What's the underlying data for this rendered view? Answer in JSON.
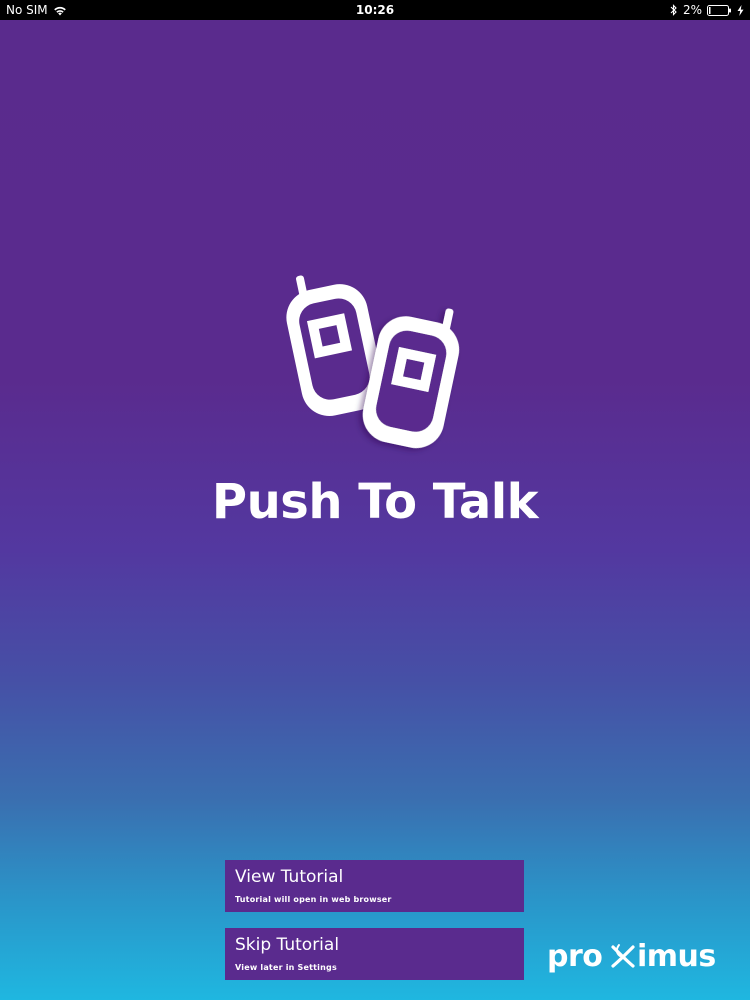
{
  "status_bar": {
    "carrier": "No SIM",
    "time": "10:26",
    "battery": "2%",
    "icons": [
      "wifi-icon",
      "bluetooth-icon",
      "battery-icon",
      "charging-bolt-icon"
    ]
  },
  "app": {
    "title": "Push To Talk",
    "logo_icon": "walkie-talkie-icon"
  },
  "buttons": {
    "view_tutorial": {
      "label": "View Tutorial",
      "sublabel": "Tutorial will open in web browser"
    },
    "skip_tutorial": {
      "label": "Skip Tutorial",
      "sublabel": "View later in Settings"
    }
  },
  "brand": {
    "name": "proximus"
  },
  "colors": {
    "button_bg": "#5a2b8e",
    "gradient_top": "#5a2b8d",
    "gradient_bottom": "#1fb7e0",
    "text": "#ffffff"
  }
}
